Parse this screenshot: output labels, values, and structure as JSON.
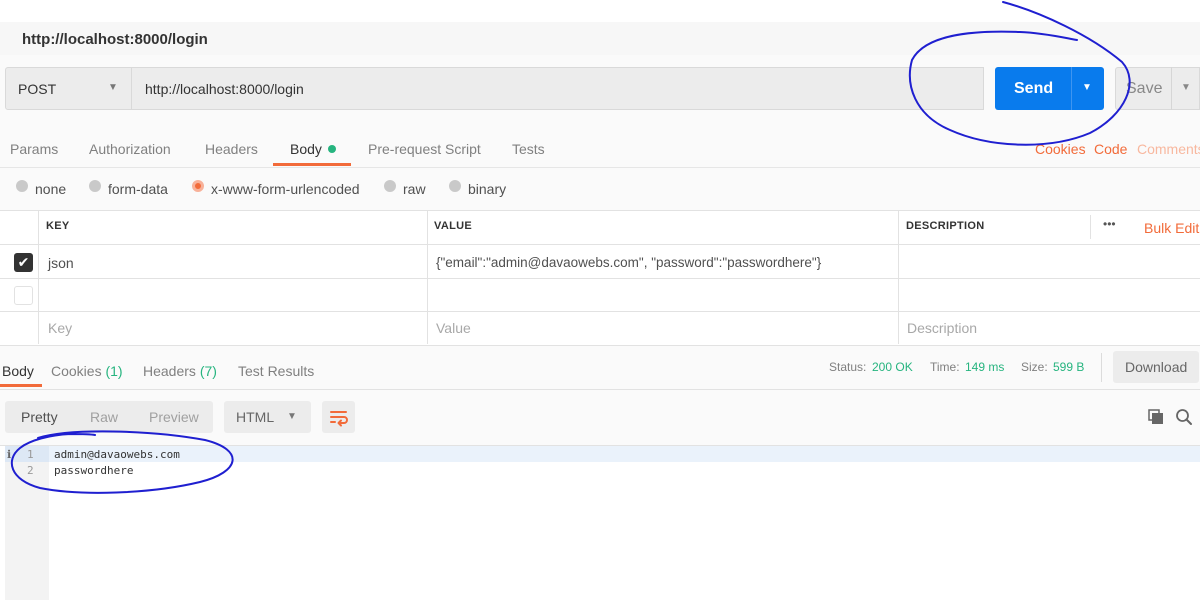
{
  "request": {
    "title": "http://localhost:8000/login",
    "method": "POST",
    "url": "http://localhost:8000/login",
    "send_label": "Send",
    "save_label": "Save"
  },
  "request_tabs": [
    {
      "label": "Params"
    },
    {
      "label": "Authorization"
    },
    {
      "label": "Headers"
    },
    {
      "label": "Body"
    },
    {
      "label": "Pre-request Script"
    },
    {
      "label": "Tests"
    }
  ],
  "request_links": {
    "cookies": "Cookies",
    "code": "Code",
    "comments": "Comments"
  },
  "body_types": [
    {
      "label": "none"
    },
    {
      "label": "form-data"
    },
    {
      "label": "x-www-form-urlencoded"
    },
    {
      "label": "raw"
    },
    {
      "label": "binary"
    }
  ],
  "params_table": {
    "headers": {
      "key": "KEY",
      "value": "VALUE",
      "description": "DESCRIPTION"
    },
    "more_label": "•••",
    "bulk_edit": "Bulk Edit",
    "rows": [
      {
        "key": "json",
        "value": "{\"email\":\"admin@davaowebs.com\", \"password\":\"passwordhere\"}",
        "checked": true
      }
    ],
    "placeholders": {
      "key": "Key",
      "value": "Value",
      "description": "Description"
    }
  },
  "response_tabs": {
    "body": "Body",
    "cookies": "Cookies",
    "cookies_count": "(1)",
    "headers": "Headers",
    "headers_count": "(7)",
    "test_results": "Test Results"
  },
  "response_status": {
    "status_label": "Status:",
    "status_value": "200 OK",
    "time_label": "Time:",
    "time_value": "149 ms",
    "size_label": "Size:",
    "size_value": "599 B",
    "download_label": "Download"
  },
  "response_view": {
    "modes": [
      {
        "label": "Pretty"
      },
      {
        "label": "Raw"
      },
      {
        "label": "Preview"
      }
    ],
    "format": "HTML"
  },
  "response_body": {
    "lines": [
      {
        "number": "1",
        "text": "admin@davaowebs.com"
      },
      {
        "number": "2",
        "text": "passwordhere"
      }
    ]
  },
  "colors": {
    "accent": "#f26b3a",
    "send_blue": "#097bed",
    "success": "#26b47f",
    "annotation": "#1a1acc"
  }
}
